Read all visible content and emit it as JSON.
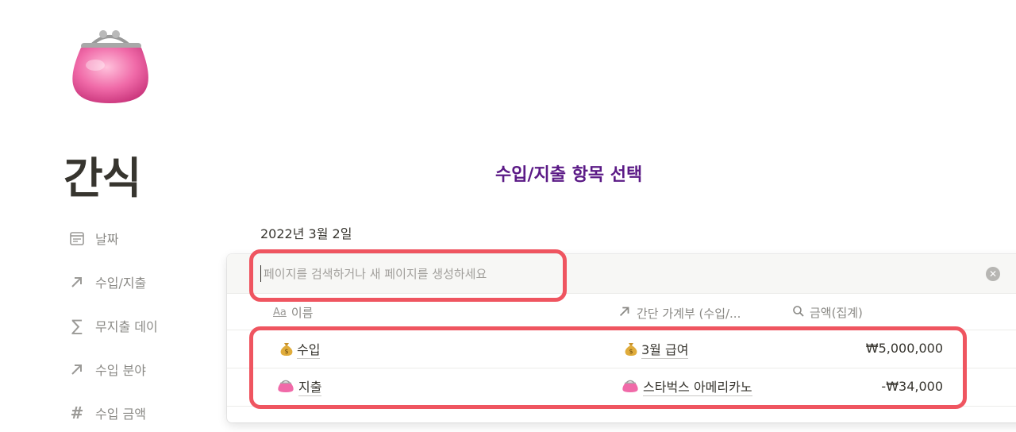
{
  "page": {
    "icon": "coin-purse-icon",
    "title": "간식"
  },
  "annotation": "수입/지출 항목 선택",
  "properties": [
    {
      "icon": "calendar-icon",
      "label": "날짜"
    },
    {
      "icon": "relation-arrow-icon",
      "label": "수입/지출"
    },
    {
      "icon": "sigma-icon",
      "label": "무지출 데이"
    },
    {
      "icon": "relation-arrow-icon",
      "label": "수입 분야"
    },
    {
      "icon": "number-hash-icon",
      "label": "수입 금액"
    }
  ],
  "date_value": "2022년 3월 2일",
  "relation_popup": {
    "search_placeholder": "페이지를 검색하거나 새 페이지를 생성하세요",
    "columns": {
      "name": {
        "icon": "Aa",
        "label": "이름"
      },
      "relation": {
        "icon": "relation-arrow-icon",
        "label": "간단 가계부 (수입/..."
      },
      "rollup": {
        "icon": "search-icon",
        "label": "금액(집계)"
      }
    },
    "rows": [
      {
        "icon": "money-bag-icon",
        "name": "수입",
        "related_icon": "money-bag-icon",
        "related": "3월 급여",
        "amount": "₩5,000,000"
      },
      {
        "icon": "coin-purse-icon",
        "name": "지출",
        "related_icon": "coin-purse-icon",
        "related": "스타벅스 아메리카노",
        "amount": "-₩34,000"
      }
    ]
  },
  "colors": {
    "highlight": "#ef5560",
    "annotation": "#5b1a86",
    "purse": "#f06aa8"
  }
}
